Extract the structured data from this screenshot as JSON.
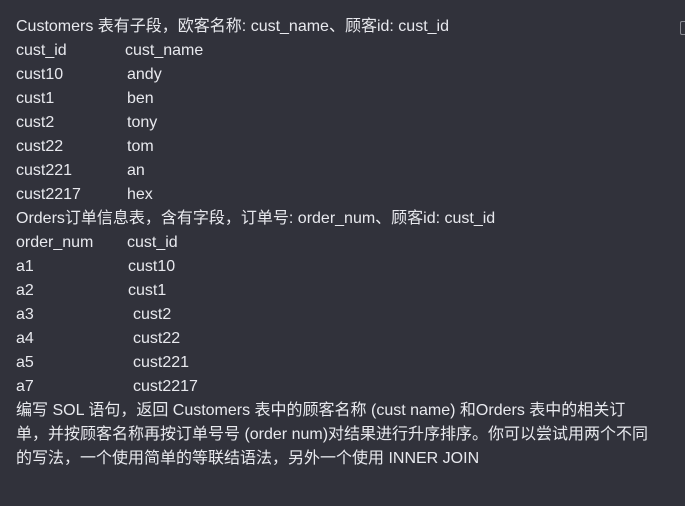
{
  "customers": {
    "intro": "Customers 表有子段，欧客名称: cust_name、顾客id: cust_id",
    "headers": [
      "cust_id",
      "cust_name"
    ],
    "rows": [
      [
        "cust10",
        "andy"
      ],
      [
        "cust1",
        "ben"
      ],
      [
        "cust2",
        "tony"
      ],
      [
        "cust22",
        "tom"
      ],
      [
        "cust221",
        "an"
      ],
      [
        "cust2217",
        "hex"
      ]
    ]
  },
  "orders": {
    "intro": "Orders订单信息表，含有字段，订单号: order_num、顾客id: cust_id",
    "headers": [
      "order_num",
      "cust_id"
    ],
    "rows": [
      [
        "a1",
        "cust10"
      ],
      [
        "a2",
        "cust1"
      ],
      [
        "a3",
        "cust2"
      ],
      [
        "a4",
        "cust22"
      ],
      [
        "a5",
        "cust221"
      ],
      [
        "a7",
        "cust2217"
      ]
    ]
  },
  "task": {
    "lines": [
      "编写 SOL 语句，返回 Customers 表中的顾客名称 (cust name) 和Orders 表中的相关订",
      "单，并按顾客名称再按订单号号 (order num)对结果进行升序排序。你可以尝试用两个不同",
      "的写法，一个使用简单的等联结语法，另外一个使用 INNER JOIN"
    ]
  }
}
